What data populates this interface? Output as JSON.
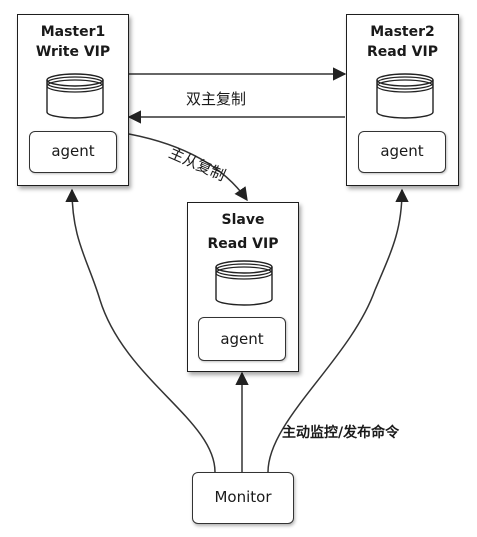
{
  "nodes": {
    "master1": {
      "line1": "Master1",
      "line2": "Write VIP",
      "agent": "agent"
    },
    "master2": {
      "line1": "Master2",
      "line2": "Read VIP",
      "agent": "agent"
    },
    "slave": {
      "line1": "Slave",
      "line2": "Read VIP",
      "agent": "agent"
    },
    "monitor": {
      "label": "Monitor"
    }
  },
  "edges": {
    "master_master": "双主复制",
    "master_slave": "主从复制",
    "monitor_control": "主动监控/发布命令"
  }
}
